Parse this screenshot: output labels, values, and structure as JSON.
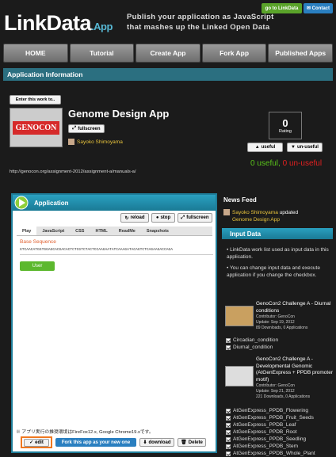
{
  "header": {
    "logo_main": "LinkData",
    "logo_sub": ".App",
    "tagline_1": "Publish your application as JavaScript",
    "tagline_2": "that mashes up the Linked Open Data",
    "goto_label": "go to LinkData",
    "contact_label": "✉ Contact"
  },
  "nav": {
    "items": [
      "HOME",
      "Tutorial",
      "Create App",
      "Fork App",
      "Published Apps"
    ]
  },
  "section_title": "Application Information",
  "app": {
    "enter_label": "Enter this work to..",
    "logo_text": "GENOCON",
    "title": "Genome Design App",
    "fullscreen_label": "fullscreen",
    "author": "Sayoko Shimoyama",
    "url": "http://genocon.org/assignment-2012/assignment-a/manuals-a/",
    "rating_value": "0",
    "rating_label": "Rating",
    "useful_label": "useful",
    "unuseful_label": "un-useful",
    "useful_count": "0",
    "useful_text": "useful,",
    "unuseful_count": "0",
    "unuseful_text": "un-useful"
  },
  "colors": {
    "teal": "#1f7e9a",
    "useful_green": "#59c21a",
    "unuseful_red": "#e02020",
    "author_yellow": "#e8c33c"
  },
  "application": {
    "header": "Application",
    "reload_label": "reload",
    "stop_label": "stop",
    "fullscreen_label": "fullscreen",
    "tabs": [
      "Play",
      "JavaScript",
      "CSS",
      "HTML",
      "ReadMe",
      "Snapshots"
    ],
    "base_seq_label": "Base Sequence",
    "sequence": "GTCAACATGGTGGAGCACGACACTCTCGTCTACTCCAAGAATATCAAAGATACAGTCTCAGAAGACCAGA",
    "user_button": "User",
    "note": "※ アプリ実行の推奨環境はFireFox12.x, Google Chrome19.xです。",
    "edit_label": "edit",
    "fork_label": "Fork this app as your new one",
    "download_label": "download",
    "delete_label": "Delete"
  },
  "news": {
    "title": "News Feed",
    "author": "Sayoko Shimoyama",
    "action": "updated",
    "app": "Genome Design App"
  },
  "input": {
    "title": "Input Data",
    "bullet1": "LinkData work list used as input data in this application.",
    "bullet2": "You can change input data and execute application if you change the checkbox.",
    "work1": {
      "title": "GenoCon2 Challenge A - Diurnal conditions",
      "contributor": "Contributor: GenoCon",
      "update": "Update: Sep 19, 2012",
      "stats": "89 Downloads, 0 Applications"
    },
    "work1_items": [
      "Circadian_condition",
      "Diurnal_condition"
    ],
    "work2": {
      "title": "GenoCon2 Challenge A - Developmental Genomic (AtGenExpress + PPDB promoter motif)",
      "contributor": "Contributor: GenoCon",
      "update": "Update: Sep 21, 2012",
      "stats": "221 Downloads, 0 Applications"
    },
    "work2_items": [
      "AtGenExpress_PPDB_Flowering",
      "AtGenExpress_PPDB_Fruit_Seeds",
      "AtGenExpress_PPDB_Leaf",
      "AtGenExpress_PPDB_Root",
      "AtGenExpress_PPDB_Seedling",
      "AtGenExpress_PPDB_Stem",
      "AtGenExpress_PPDB_Whole_Plant"
    ]
  }
}
